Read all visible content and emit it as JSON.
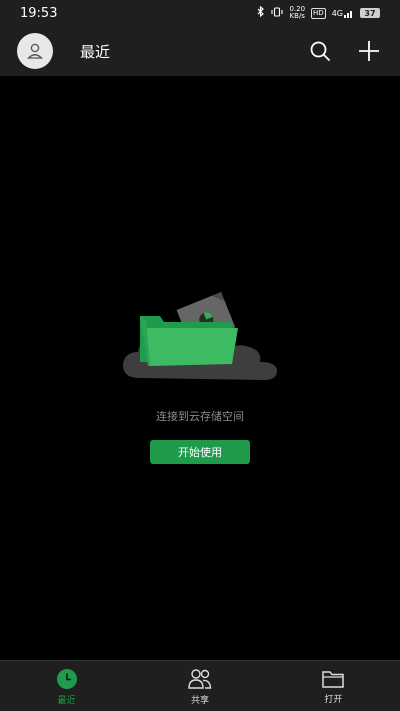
{
  "status_bar": {
    "time": "19:53",
    "speed_value": "0.20",
    "speed_unit": "KB/s",
    "hd_label": "HD",
    "network_label": "4G",
    "battery": "37"
  },
  "header": {
    "title": "最近"
  },
  "empty_state": {
    "message": "连接到云存储空间",
    "button_label": "开始使用"
  },
  "bottom_nav": {
    "items": [
      {
        "label": "最近",
        "icon": "clock-icon",
        "active": true
      },
      {
        "label": "共享",
        "icon": "people-icon",
        "active": false
      },
      {
        "label": "打开",
        "icon": "folder-icon",
        "active": false
      }
    ]
  },
  "colors": {
    "accent": "#1e9b4b",
    "background": "#000000",
    "bar": "#1f1f1f"
  }
}
